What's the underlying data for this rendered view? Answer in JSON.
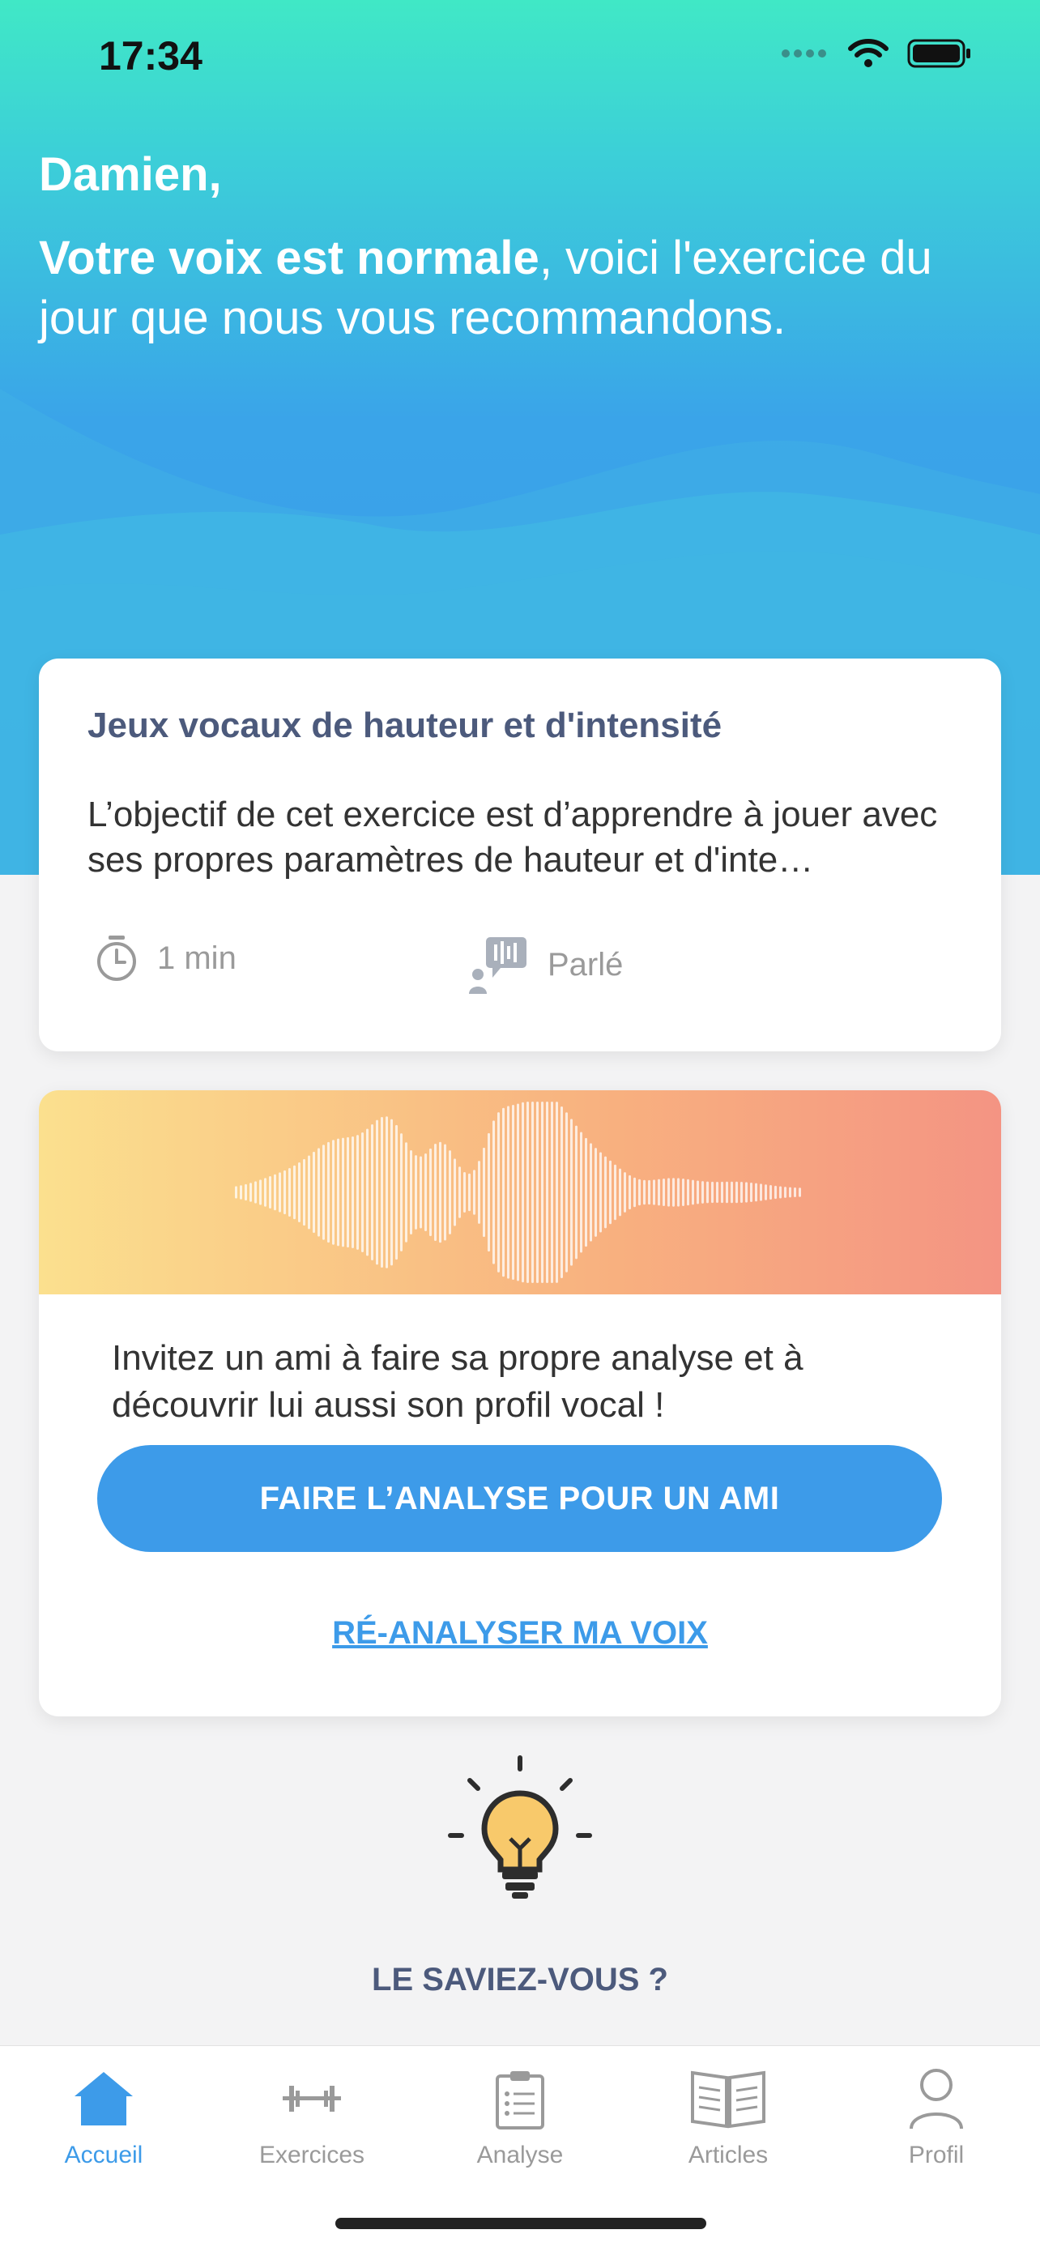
{
  "status_bar": {
    "time": "17:34"
  },
  "header": {
    "greeting": "Damien,",
    "headline_bold": "Votre voix est normale",
    "headline_rest": ", voici l'exercice du jour que nous vous recommandons."
  },
  "exercise_card": {
    "title": "Jeux vocaux de hauteur et d'intensité",
    "description": "L’objectif de cet exercice est d’apprendre à jouer avec ses propres paramètres de hauteur et d'inte…",
    "duration": "1 min",
    "type": "Parlé"
  },
  "invite_card": {
    "text": "Invitez un ami à faire sa propre analyse et à découvrir lui aussi son profil vocal !",
    "button_label": "FAIRE L’ANALYSE POUR UN AMI",
    "link_label": "RÉ-ANALYSER MA VOIX"
  },
  "tip": {
    "title": "LE SAVIEZ-VOUS ?"
  },
  "tab_bar": {
    "items": [
      {
        "label": "Accueil",
        "icon": "home-icon"
      },
      {
        "label": "Exercices",
        "icon": "dumbbell-icon"
      },
      {
        "label": "Analyse",
        "icon": "clipboard-icon"
      },
      {
        "label": "Articles",
        "icon": "book-icon"
      },
      {
        "label": "Profil",
        "icon": "user-icon"
      }
    ],
    "active": "Accueil"
  },
  "colors": {
    "accent": "#3d9be9",
    "title_text": "#4c5a7c",
    "hero_top": "#40e8c6",
    "hero_bottom": "#3b9ce9"
  }
}
